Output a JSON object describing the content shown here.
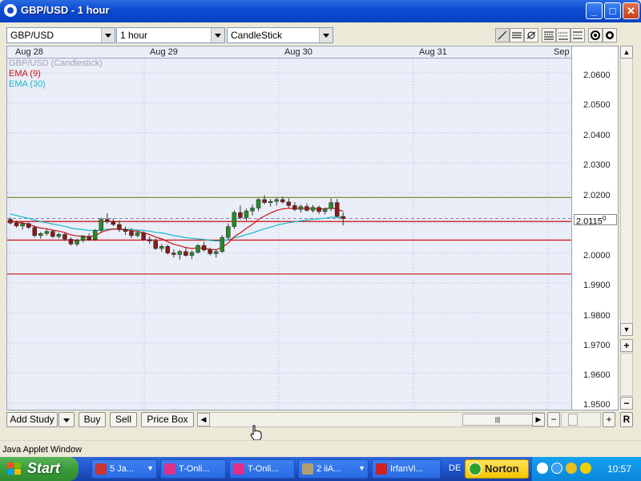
{
  "window": {
    "title": "GBP/USD - 1 hour"
  },
  "toolbar": {
    "symbol": "GBP/USD",
    "interval": "1 hour",
    "chart_type": "CandleStick"
  },
  "legend": {
    "main": "GBP/USD (Candlestick)",
    "ema9": "EMA (9)",
    "ema30": "EMA (30)"
  },
  "colors": {
    "ema9": "#cc1111",
    "ema30": "#19b8c8",
    "up": "#2a8a2a",
    "down": "#8a1a1a",
    "resistance": "#6a8a10",
    "support": "#cc1010"
  },
  "dates": [
    "Aug 28",
    "Aug 29",
    "Aug 30",
    "Aug 31",
    "Sep"
  ],
  "price_ticks": [
    "2.0600",
    "2.0500",
    "2.0400",
    "2.0300",
    "2.0200",
    "2.0115",
    "2.0000",
    "1.9900",
    "1.9800",
    "1.9700",
    "1.9600",
    "1.9500"
  ],
  "current_price": {
    "main": "2.0115",
    "sup": "0"
  },
  "bottom": {
    "add_study": "Add Study",
    "buy": "Buy",
    "sell": "Sell",
    "price_box": "Price Box",
    "r": "R"
  },
  "scroll": {
    "minus": "−",
    "plus": "+"
  },
  "status": {
    "applet": "Java Applet Window"
  },
  "taskbar": {
    "start": "Start",
    "tasks": [
      "5 Ja...",
      "T-Onli...",
      "T-Onli...",
      "2 iiA...",
      "IrfanVi..."
    ],
    "lang": "DE",
    "norton": "Norton",
    "clock": "10:57"
  },
  "chart_data": {
    "type": "candlestick",
    "title": "GBP/USD (Candlestick)",
    "interval": "1 hour",
    "ylim": [
      1.9478,
      2.0648
    ],
    "x_labels": [
      "Aug 28",
      "Aug 29",
      "Aug 30",
      "Aug 31",
      "Sep"
    ],
    "candles": [
      [
        2.0112,
        2.0118,
        2.0095,
        2.01
      ],
      [
        2.01,
        2.0108,
        2.0085,
        2.009
      ],
      [
        2.009,
        2.0105,
        2.0078,
        2.0098
      ],
      [
        2.0098,
        2.0102,
        2.008,
        2.0085
      ],
      [
        2.0085,
        2.0092,
        2.0052,
        2.0058
      ],
      [
        2.0058,
        2.007,
        2.0048,
        2.0065
      ],
      [
        2.0065,
        2.008,
        2.0058,
        2.0072
      ],
      [
        2.0072,
        2.0078,
        2.005,
        2.0055
      ],
      [
        2.0055,
        2.0068,
        2.0048,
        2.0062
      ],
      [
        2.0062,
        2.007,
        2.004,
        2.0046
      ],
      [
        2.0046,
        2.0052,
        2.0025,
        2.003
      ],
      [
        2.003,
        2.0048,
        2.0022,
        2.0042
      ],
      [
        2.0042,
        2.006,
        2.0035,
        2.0055
      ],
      [
        2.0055,
        2.0065,
        2.004,
        2.0045
      ],
      [
        2.0045,
        2.008,
        2.004,
        2.0075
      ],
      [
        2.0075,
        2.0118,
        2.007,
        2.0112
      ],
      [
        2.0112,
        2.0132,
        2.0098,
        2.0105
      ],
      [
        2.0105,
        2.0115,
        2.009,
        2.0095
      ],
      [
        2.0095,
        2.0108,
        2.007,
        2.0078
      ],
      [
        2.0078,
        2.0088,
        2.006,
        2.0072
      ],
      [
        2.0072,
        2.0082,
        2.005,
        2.0058
      ],
      [
        2.0058,
        2.0075,
        2.0052,
        2.0068
      ],
      [
        2.0068,
        2.0072,
        2.004,
        2.0045
      ],
      [
        2.0045,
        2.0055,
        2.003,
        2.004
      ],
      [
        2.004,
        2.0048,
        2.001,
        2.0015
      ],
      [
        2.0015,
        2.003,
        2.0005,
        2.0022
      ],
      [
        2.0022,
        2.0028,
        1.9995,
        2.0
      ],
      [
        2.0,
        2.0012,
        1.9985,
        1.9995
      ],
      [
        1.9995,
        2.001,
        1.9978,
        2.0005
      ],
      [
        2.0005,
        2.002,
        1.9988,
        1.9992
      ],
      [
        1.9992,
        2.0008,
        1.998,
        2.0002
      ],
      [
        2.0002,
        2.003,
        1.9998,
        2.0025
      ],
      [
        2.0025,
        2.0038,
        2.0005,
        2.001
      ],
      [
        2.001,
        2.0018,
        1.9992,
        1.9998
      ],
      [
        1.9998,
        2.001,
        1.9985,
        2.0005
      ],
      [
        2.0005,
        2.006,
        2.0,
        2.0052
      ],
      [
        2.0052,
        2.0098,
        2.0045,
        2.0088
      ],
      [
        2.0088,
        2.0142,
        2.008,
        2.0135
      ],
      [
        2.0135,
        2.0158,
        2.0112,
        2.0118
      ],
      [
        2.0118,
        2.0148,
        2.0108,
        2.014
      ],
      [
        2.014,
        2.0162,
        2.0125,
        2.015
      ],
      [
        2.015,
        2.0182,
        2.014,
        2.0178
      ],
      [
        2.0178,
        2.0192,
        2.0162,
        2.0168
      ],
      [
        2.0168,
        2.018,
        2.0155,
        2.0172
      ],
      [
        2.0172,
        2.0185,
        2.0158,
        2.0178
      ],
      [
        2.0178,
        2.0188,
        2.0165,
        2.017
      ],
      [
        2.017,
        2.0182,
        2.015,
        2.0158
      ],
      [
        2.0158,
        2.017,
        2.014,
        2.0145
      ],
      [
        2.0145,
        2.0162,
        2.0135,
        2.0155
      ],
      [
        2.0155,
        2.0165,
        2.0138,
        2.0142
      ],
      [
        2.0142,
        2.016,
        2.0135,
        2.0152
      ],
      [
        2.0152,
        2.0158,
        2.013,
        2.0138
      ],
      [
        2.0138,
        2.0152,
        2.0128,
        2.0148
      ],
      [
        2.0148,
        2.0182,
        2.014,
        2.0168
      ],
      [
        2.0168,
        2.018,
        2.0118,
        2.0122
      ],
      [
        2.0122,
        2.0135,
        2.0092,
        2.0115
      ]
    ],
    "ema9": [
      2.0108,
      2.0102,
      2.01,
      2.0096,
      2.0088,
      2.0083,
      2.0081,
      2.0076,
      2.0073,
      2.0068,
      2.006,
      2.0057,
      2.0056,
      2.0054,
      2.0058,
      2.0069,
      2.0076,
      2.008,
      2.0079,
      2.0078,
      2.0074,
      2.0073,
      2.0067,
      2.0062,
      2.0053,
      2.0047,
      2.0038,
      2.0029,
      2.0024,
      2.0018,
      2.0015,
      2.0017,
      2.0016,
      2.0012,
      2.0011,
      2.0019,
      2.0033,
      2.0054,
      2.0067,
      2.0082,
      2.0095,
      2.0112,
      2.0123,
      2.0133,
      2.0142,
      2.0147,
      2.0149,
      2.0148,
      2.015,
      2.0148,
      2.0149,
      2.0147,
      2.0147,
      2.0151,
      2.0145,
      2.0139
    ],
    "ema30": [
      2.013,
      2.0125,
      2.012,
      2.0116,
      2.011,
      2.0105,
      2.0101,
      2.0096,
      2.0093,
      2.0089,
      2.0083,
      2.008,
      2.0078,
      2.0075,
      2.0075,
      2.0077,
      2.0079,
      2.008,
      2.008,
      2.0079,
      2.0078,
      2.0077,
      2.0075,
      2.0073,
      2.0069,
      2.0067,
      2.0063,
      2.0058,
      2.0055,
      2.0051,
      2.0049,
      2.0047,
      2.0045,
      2.0042,
      2.004,
      2.0041,
      2.0044,
      2.005,
      2.0055,
      2.0061,
      2.0067,
      2.0074,
      2.0081,
      2.0086,
      2.0092,
      2.0097,
      2.0101,
      2.0104,
      2.0107,
      2.011,
      2.0112,
      2.0114,
      2.0116,
      2.0119,
      2.0119,
      2.0119
    ],
    "horizontal_lines": [
      {
        "price": 2.0185,
        "color": "#6a8a10"
      },
      {
        "price": 2.0105,
        "color": "#cc1010"
      },
      {
        "price": 2.0043,
        "color": "#cc1010"
      },
      {
        "price": 1.993,
        "color": "#cc1010"
      },
      {
        "price": 2.0115,
        "color": "#8080a0",
        "dashed": true
      }
    ]
  }
}
